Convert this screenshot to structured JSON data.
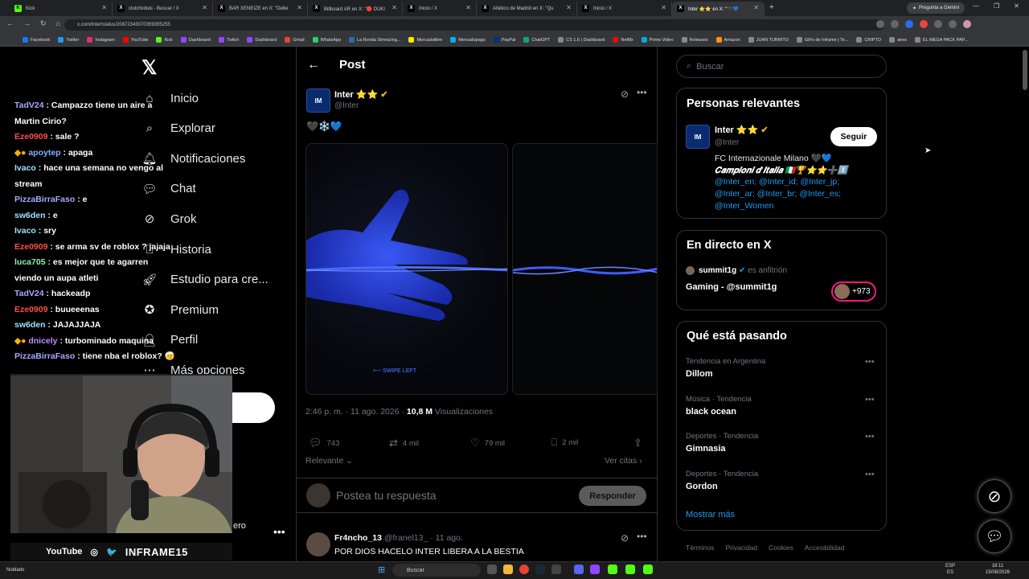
{
  "browser": {
    "tabs": [
      {
        "label": "Kick",
        "fav": "K",
        "color": "#53fc18"
      },
      {
        "label": "clutchxduki - Buscar / X",
        "fav": "X",
        "color": "#000000"
      },
      {
        "label": "BAR XENEIZE en X: \"Debe",
        "fav": "X",
        "color": "#000000"
      },
      {
        "label": "Billboard AR en X: \"🔴 DUKI",
        "fav": "X",
        "color": "#000000"
      },
      {
        "label": "Inicio / X",
        "fav": "X",
        "color": "#000000"
      },
      {
        "label": "Atlético de Madrid en X: \"Qu",
        "fav": "X",
        "color": "#000000"
      },
      {
        "label": "Inicio / X",
        "fav": "X",
        "color": "#000000"
      },
      {
        "label": "Inter ⭐⭐ en X: \"🖤💙",
        "fav": "X",
        "color": "#000000"
      }
    ],
    "gemini": "Pregunta a Gemini",
    "url": "x.com/Inter/status/20872343070359355255",
    "bookmarks": [
      {
        "label": "Facebook",
        "color": "#1877f2"
      },
      {
        "label": "Twitter",
        "color": "#1d9bf0"
      },
      {
        "label": "Instagram",
        "color": "#e1306c"
      },
      {
        "label": "YouTube",
        "color": "#ff0000"
      },
      {
        "label": "Kick",
        "color": "#53fc18"
      },
      {
        "label": "Dashboard",
        "color": "#9146ff"
      },
      {
        "label": "Twitch",
        "color": "#9146ff"
      },
      {
        "label": "Dashboard",
        "color": "#9146ff"
      },
      {
        "label": "Gmail",
        "color": "#ea4335"
      },
      {
        "label": "WhatsApp",
        "color": "#25d366"
      },
      {
        "label": "La Ronda Simracing...",
        "color": "#2b6cb0"
      },
      {
        "label": "Mercadolibre",
        "color": "#ffe600"
      },
      {
        "label": "Mercadopago",
        "color": "#00b1ea"
      },
      {
        "label": "PayPal",
        "color": "#003087"
      },
      {
        "label": "ChatGPT",
        "color": "#10a37f"
      },
      {
        "label": "CS 1.6 | Dashboard",
        "color": "#888888"
      },
      {
        "label": "Netflix",
        "color": "#e50914"
      },
      {
        "label": "Prime Video",
        "color": "#00a8e1"
      },
      {
        "label": "Releases",
        "color": "#888888"
      },
      {
        "label": "Amazon",
        "color": "#ff9900"
      },
      {
        "label": "JUAN TURRITO",
        "color": "#888888"
      },
      {
        "label": "GIFs de Inframe | Te...",
        "color": "#888888"
      },
      {
        "label": "CRIPTO",
        "color": "#888888"
      },
      {
        "label": "aires",
        "color": "#888888"
      },
      {
        "label": "EL MEGA PACK PAP...",
        "color": "#888888"
      }
    ]
  },
  "nav": {
    "items": [
      {
        "label": "Inicio",
        "icon": "home-icon"
      },
      {
        "label": "Explorar",
        "icon": "search-icon"
      },
      {
        "label": "Notificaciones",
        "icon": "bell-icon"
      },
      {
        "label": "Chat",
        "icon": "chat-icon"
      },
      {
        "label": "Grok",
        "icon": "grok-icon"
      },
      {
        "label": "Historia",
        "icon": "bookmark-icon"
      },
      {
        "label": "Estudio para cre...",
        "icon": "rocket-icon"
      },
      {
        "label": "Premium",
        "icon": "verified-icon"
      },
      {
        "label": "Perfil",
        "icon": "person-icon"
      },
      {
        "label": "Más opciones",
        "icon": "more-icon"
      }
    ],
    "profile_fragment": "ero"
  },
  "stream_chat": [
    {
      "user": "TadV24",
      "color": "#a9a9ff",
      "text": "Campazzo tiene un aire a Martin Cirio?"
    },
    {
      "user": "Eze0909",
      "color": "#ff4d4d",
      "text": "sale ?"
    },
    {
      "user": "apoytep",
      "color": "#7fb3ff",
      "text": "apaga",
      "badge": true
    },
    {
      "user": "Ivaco",
      "color": "#9fe0ff",
      "text": "hace una semana no vengo al stream"
    },
    {
      "user": "PizzaBirraFaso",
      "color": "#a9a9ff",
      "text": "e"
    },
    {
      "user": "sw6den",
      "color": "#9fe0ff",
      "text": "e"
    },
    {
      "user": "Ivaco",
      "color": "#9fe0ff",
      "text": "sry"
    },
    {
      "user": "Eze0909",
      "color": "#ff4d4d",
      "text": "se arma sv de roblox ? jajaja"
    },
    {
      "user": "luca705",
      "color": "#8cf0b0",
      "text": "es mejor que te agarren viendo un aupa atleti"
    },
    {
      "user": "TadV24",
      "color": "#a9a9ff",
      "text": "hackeadp"
    },
    {
      "user": "Eze0909",
      "color": "#ff4d4d",
      "text": "buueeenas"
    },
    {
      "user": "sw6den",
      "color": "#9fe0ff",
      "text": "JAJAJJAJA"
    },
    {
      "user": "dnicely",
      "color": "#c08cff",
      "text": "turbominado maquina",
      "badge": true
    },
    {
      "user": "PizzaBirraFaso",
      "color": "#a9a9ff",
      "text": "tiene nba el roblox? 🤕"
    }
  ],
  "stream_footer": {
    "youtube": "YouTube",
    "handle": "INFRAME15"
  },
  "post": {
    "header": "Post",
    "author_name": "Inter ⭐⭐",
    "author_handle": "@Inter",
    "avatar_text": "IM",
    "emojis": "🖤❄️💙",
    "swipe": "⟵  SWIPE LEFT",
    "time": "2:46 p. m. · 11 ago. 2026 · ",
    "views_count": "10,8 M",
    "views_label": " Visualizaciones",
    "replies": "743",
    "reposts": "4 mil",
    "likes": "79 mil",
    "bookmarks": "2 mil",
    "sort": "Relevante",
    "quotes": "Ver citas",
    "reply_placeholder": "Postea tu respuesta",
    "reply_button": "Responder"
  },
  "comment": {
    "name": "Fr4ncho_13",
    "meta": " @franel13_ · 11 ago.",
    "text": "POR DIOS HACELO INTER LIBERA A LA BESTIA"
  },
  "sidebar": {
    "search_placeholder": "Buscar",
    "relevant": {
      "title": "Personas relevantes",
      "name": "Inter ⭐⭐",
      "handle": "@Inter",
      "follow": "Seguir",
      "bio1": "FC Internazionale Milano 🖤💙",
      "bio2": "𝑪𝒂𝒎𝒑𝒊𝒐𝒏𝒊 𝒅'𝑰𝒕𝒂𝒍𝒊𝒂 🇮🇹🏆⭐⭐➕1️⃣",
      "links1": "@Inter_en; @Inter_id; @Inter_jp;",
      "links2": "@Inter_ar; @Inter_br; @Inter_es;",
      "links3": "@Inter_Women"
    },
    "live": {
      "title": "En directo en X",
      "host": "summit1g",
      "host_role": " es anfitrión",
      "space": "Gaming - @summit1g",
      "listeners": "+973"
    },
    "trends": {
      "title": "Qué está pasando",
      "items": [
        {
          "category": "Tendencia en Argentina",
          "name": "Dillom"
        },
        {
          "category": "Música · Tendencia",
          "name": "black ocean"
        },
        {
          "category": "Deportes · Tendencia",
          "name": "Gimnasia"
        },
        {
          "category": "Deportes · Tendencia",
          "name": "Gordon"
        }
      ],
      "more": "Mostrar más"
    },
    "footer": [
      "Términos",
      "Privacidad",
      "Cookies",
      "Accesibilidad"
    ]
  },
  "taskbar": {
    "weather": "Nublado",
    "search": "Buscar",
    "lang1": "ESP",
    "lang2": "ES",
    "time": "18:11",
    "date": "15/08/2026"
  }
}
